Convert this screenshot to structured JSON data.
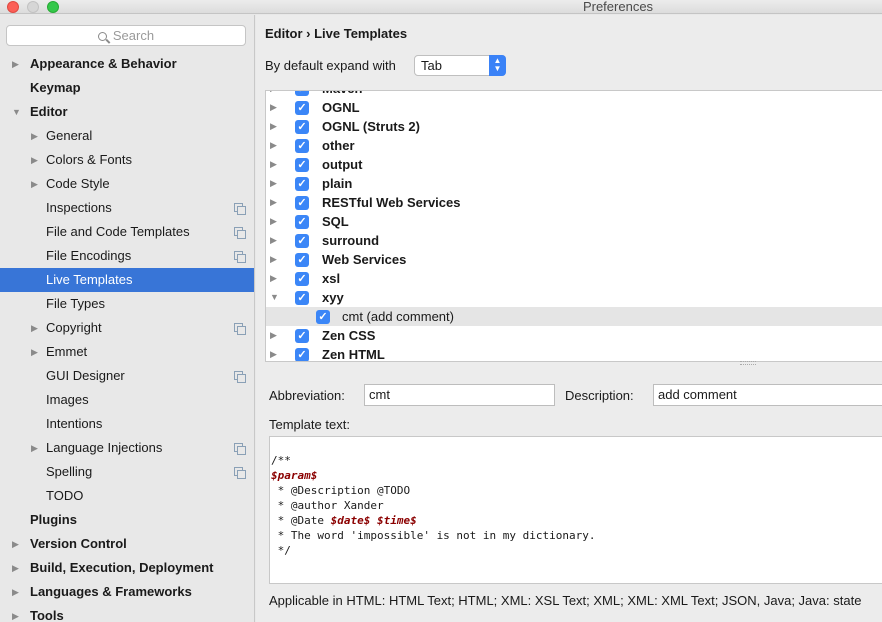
{
  "window": {
    "title": "Preferences"
  },
  "sidebar": {
    "search_placeholder": "Search",
    "items": [
      {
        "label": "Appearance & Behavior",
        "level": 0,
        "arrow": "▶",
        "top": true
      },
      {
        "label": "Keymap",
        "level": 0,
        "arrow": "",
        "top": true
      },
      {
        "label": "Editor",
        "level": 0,
        "arrow": "▼",
        "top": true
      },
      {
        "label": "General",
        "level": 1,
        "arrow": "▶"
      },
      {
        "label": "Colors & Fonts",
        "level": 1,
        "arrow": "▶"
      },
      {
        "label": "Code Style",
        "level": 1,
        "arrow": "▶"
      },
      {
        "label": "Inspections",
        "level": 1,
        "arrow": "",
        "copy": true
      },
      {
        "label": "File and Code Templates",
        "level": 1,
        "arrow": "",
        "copy": true
      },
      {
        "label": "File Encodings",
        "level": 1,
        "arrow": "",
        "copy": true
      },
      {
        "label": "Live Templates",
        "level": 1,
        "arrow": "",
        "selected": true
      },
      {
        "label": "File Types",
        "level": 1,
        "arrow": ""
      },
      {
        "label": "Copyright",
        "level": 1,
        "arrow": "▶",
        "copy": true
      },
      {
        "label": "Emmet",
        "level": 1,
        "arrow": "▶"
      },
      {
        "label": "GUI Designer",
        "level": 1,
        "arrow": "",
        "copy": true
      },
      {
        "label": "Images",
        "level": 1,
        "arrow": ""
      },
      {
        "label": "Intentions",
        "level": 1,
        "arrow": ""
      },
      {
        "label": "Language Injections",
        "level": 1,
        "arrow": "▶",
        "copy": true
      },
      {
        "label": "Spelling",
        "level": 1,
        "arrow": "",
        "copy": true
      },
      {
        "label": "TODO",
        "level": 1,
        "arrow": ""
      },
      {
        "label": "Plugins",
        "level": 0,
        "arrow": "",
        "top": true
      },
      {
        "label": "Version Control",
        "level": 0,
        "arrow": "▶",
        "top": true
      },
      {
        "label": "Build, Execution, Deployment",
        "level": 0,
        "arrow": "▶",
        "top": true
      },
      {
        "label": "Languages & Frameworks",
        "level": 0,
        "arrow": "▶",
        "top": true
      },
      {
        "label": "Tools",
        "level": 0,
        "arrow": "▶",
        "top": true
      }
    ]
  },
  "main": {
    "breadcrumb": "Editor › Live Templates",
    "expand_label": "By default expand with",
    "expand_value": "Tab",
    "templates": [
      {
        "label": "Maven",
        "arrow": "▶",
        "checked": true
      },
      {
        "label": "OGNL",
        "arrow": "▶",
        "checked": true
      },
      {
        "label": "OGNL (Struts 2)",
        "arrow": "▶",
        "checked": true
      },
      {
        "label": "other",
        "arrow": "▶",
        "checked": true
      },
      {
        "label": "output",
        "arrow": "▶",
        "checked": true
      },
      {
        "label": "plain",
        "arrow": "▶",
        "checked": true
      },
      {
        "label": "RESTful Web Services",
        "arrow": "▶",
        "checked": true
      },
      {
        "label": "SQL",
        "arrow": "▶",
        "checked": true
      },
      {
        "label": "surround",
        "arrow": "▶",
        "checked": true
      },
      {
        "label": "Web Services",
        "arrow": "▶",
        "checked": true
      },
      {
        "label": "xsl",
        "arrow": "▶",
        "checked": true
      },
      {
        "label": "xyy",
        "arrow": "▼",
        "checked": true
      },
      {
        "label": "cmt (add comment)",
        "arrow": "",
        "checked": true,
        "child": true
      },
      {
        "label": "Zen CSS",
        "arrow": "▶",
        "checked": true
      },
      {
        "label": "Zen HTML",
        "arrow": "▶",
        "checked": true
      }
    ],
    "abbreviation_label": "Abbreviation:",
    "abbreviation_value": "cmt",
    "description_label": "Description:",
    "description_value": "add comment",
    "template_text_label": "Template text:",
    "template_lines": [
      [
        {
          "t": "/**"
        }
      ],
      [
        {
          "t": "$param$",
          "v": true
        }
      ],
      [
        {
          "t": " * @Description @TODO"
        }
      ],
      [
        {
          "t": " * @author Xander"
        }
      ],
      [
        {
          "t": " * @Date "
        },
        {
          "t": "$date$",
          "v": true
        },
        {
          "t": " "
        },
        {
          "t": "$time$",
          "v": true
        }
      ],
      [
        {
          "t": " * The word 'impossible' is not in my dictionary."
        }
      ],
      [
        {
          "t": " */"
        }
      ]
    ],
    "applicable": "Applicable in HTML: HTML Text; HTML; XML: XSL Text; XML; XML: XML Text; JSON, Java; Java: state"
  }
}
